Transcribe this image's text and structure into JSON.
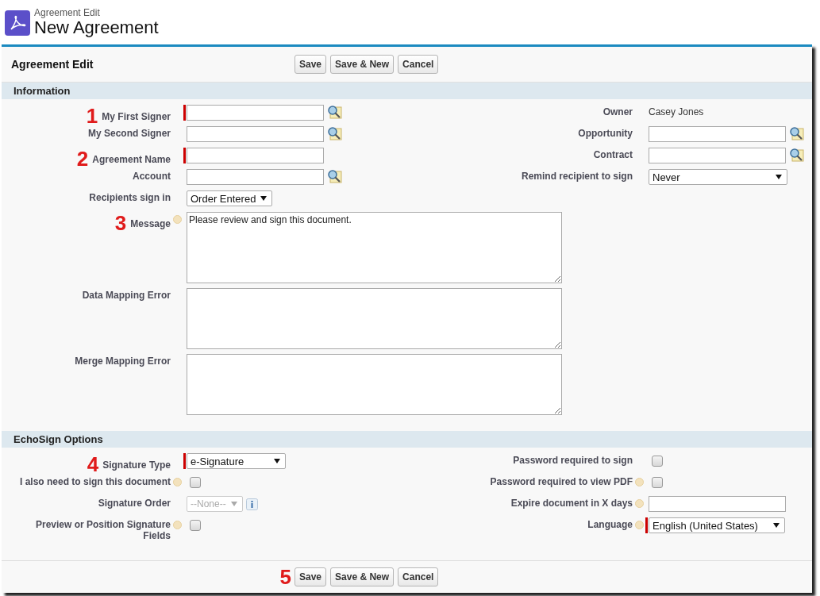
{
  "header": {
    "breadcrumb": "Agreement Edit",
    "title": "New Agreement"
  },
  "toolbar": {
    "title": "Agreement Edit",
    "buttons": [
      "Save",
      "Save & New",
      "Cancel"
    ]
  },
  "sections": [
    {
      "title": "Information",
      "left": [
        {
          "label": "My First Signer",
          "kind": "lookup",
          "required": true,
          "help": false,
          "callout": "1"
        },
        {
          "label": "My Second Signer",
          "kind": "lookup",
          "required": false,
          "help": false
        },
        {
          "label": "Agreement Name",
          "kind": "text",
          "required": true,
          "help": false,
          "callout": "2"
        },
        {
          "label": "Account",
          "kind": "lookup",
          "required": false,
          "help": false
        },
        {
          "label": "Recipients sign in",
          "kind": "select",
          "required": false,
          "help": false,
          "value": "Order Entered",
          "disabled": false
        },
        {
          "label": "Message",
          "kind": "textarea",
          "required": false,
          "help": true,
          "callout": "3",
          "value": "Please review and sign this document."
        },
        {
          "label": "Data Mapping Error",
          "kind": "textarea",
          "required": false,
          "help": false
        },
        {
          "label": "Merge Mapping Error",
          "kind": "textarea",
          "required": false,
          "help": false
        }
      ],
      "right": [
        {
          "label": "Owner",
          "kind": "readonly",
          "required": false,
          "help": false,
          "value": "Casey Jones"
        },
        {
          "label": "Opportunity",
          "kind": "lookup",
          "required": false,
          "help": false
        },
        {
          "label": "Contract",
          "kind": "lookup",
          "required": false,
          "help": false
        },
        {
          "label": "Remind recipient to sign",
          "kind": "select",
          "required": false,
          "help": false,
          "value": "Never",
          "disabled": false
        }
      ]
    },
    {
      "title": "EchoSign Options",
      "left": [
        {
          "label": "Signature Type",
          "kind": "select",
          "required": true,
          "help": false,
          "callout": "4",
          "value": "e-Signature",
          "disabled": false
        },
        {
          "label": "I also need to sign this document",
          "kind": "checkbox",
          "required": false,
          "help": true,
          "checked": false
        },
        {
          "label": "Signature Order",
          "kind": "select",
          "required": false,
          "help": false,
          "value": "--None--",
          "disabled": true,
          "info": true
        },
        {
          "label": "Preview or Position Signature Fields",
          "kind": "checkbox",
          "required": false,
          "help": true,
          "checked": false
        }
      ],
      "right": [
        {
          "label": "Password required to sign",
          "kind": "checkbox",
          "required": false,
          "help": false,
          "checked": false
        },
        {
          "label": "Password required to view PDF",
          "kind": "checkbox",
          "required": false,
          "help": true,
          "checked": false
        },
        {
          "label": "Expire document in X days",
          "kind": "text",
          "required": false,
          "help": true
        },
        {
          "label": "Language",
          "kind": "select",
          "required": true,
          "help": true,
          "value": "English (United States)",
          "disabled": false
        }
      ]
    }
  ],
  "footer": {
    "callout": "5",
    "buttons": [
      "Save",
      "Save & New",
      "Cancel"
    ]
  }
}
